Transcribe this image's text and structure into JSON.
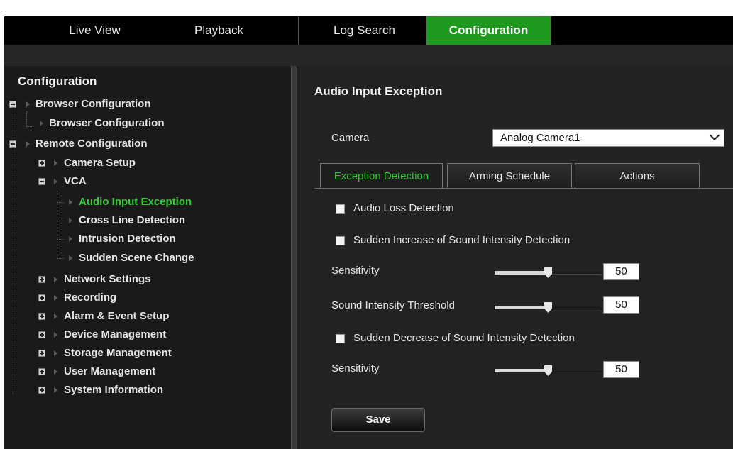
{
  "nav": {
    "tabs": [
      {
        "label": "Live View"
      },
      {
        "label": "Playback"
      },
      {
        "label": "Log Search"
      },
      {
        "label": "Configuration"
      }
    ],
    "active": "Configuration"
  },
  "sidebar": {
    "title": "Configuration",
    "items": [
      {
        "label": "Browser Configuration"
      },
      {
        "label": "Browser Configuration"
      },
      {
        "label": "Remote Configuration"
      },
      {
        "label": "Camera Setup"
      },
      {
        "label": "VCA"
      },
      {
        "label": "Audio Input Exception"
      },
      {
        "label": "Cross Line Detection"
      },
      {
        "label": "Intrusion Detection"
      },
      {
        "label": "Sudden Scene Change"
      },
      {
        "label": "Network Settings"
      },
      {
        "label": "Recording"
      },
      {
        "label": "Alarm & Event Setup"
      },
      {
        "label": "Device Management"
      },
      {
        "label": "Storage Management"
      },
      {
        "label": "User Management"
      },
      {
        "label": "System Information"
      }
    ],
    "selected": "Audio Input Exception"
  },
  "main": {
    "title": "Audio Input Exception",
    "camera_label": "Camera",
    "camera_value": "Analog Camera1",
    "tabs": [
      {
        "label": "Exception Detection"
      },
      {
        "label": "Arming Schedule"
      },
      {
        "label": "Actions"
      }
    ],
    "active_tab": "Exception Detection",
    "audio_loss_label": "Audio Loss Detection",
    "audio_loss_checked": false,
    "increase_label": "Sudden Increase of Sound Intensity Detection",
    "increase_checked": false,
    "sensitivity_label": "Sensitivity",
    "sensitivity_value": "50",
    "threshold_label": "Sound Intensity Threshold",
    "threshold_value": "50",
    "decrease_label": "Sudden Decrease of Sound Intensity Detection",
    "decrease_checked": false,
    "sensitivity2_label": "Sensitivity",
    "sensitivity2_value": "50",
    "save_label": "Save"
  },
  "colors": {
    "accent": "#1e9a1e",
    "active_text": "#33cc33",
    "panel_bg": "#222222",
    "sidebar_bg": "#1a1a1a"
  },
  "icons": {
    "tree_collapse": "minus-box-icon",
    "tree_expand": "plus-box-icon",
    "tree_arrow": "right-triangle-icon",
    "dropdown": "chevron-down-icon"
  }
}
